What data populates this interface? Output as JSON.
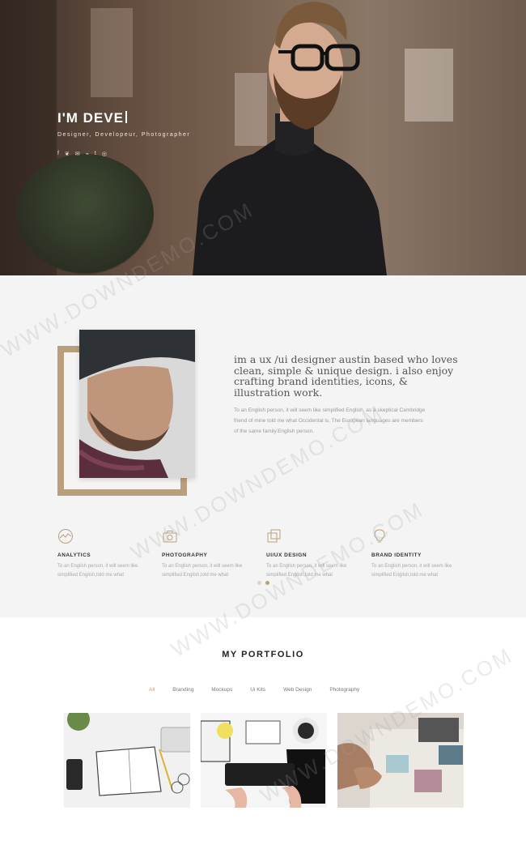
{
  "hero": {
    "title": "I'M DEVE",
    "subtitle": "Designer, Developeur, Photographer",
    "social_icons": [
      "facebook-icon",
      "twitter-icon",
      "email-icon",
      "rss-icon",
      "tumblr-icon",
      "instagram-icon"
    ],
    "social_glyphs": [
      "f",
      "❦",
      "✉",
      "⌁",
      "t",
      "◎"
    ]
  },
  "about": {
    "heading": "im a ux /ui designer austin based who loves clean, simple & unique design. i also enjoy crafting brand identities, icons, & illustration work.",
    "text": "To an English person, it will seem like simplified English, as a skeptical Cambridge friend of mine told me what Occidental is. The European languages are members of the same family.English person."
  },
  "services": [
    {
      "icon": "analytics-icon",
      "title": "ANALYTICS",
      "desc": "To an English person, it will seem like simplified English,told me what"
    },
    {
      "icon": "camera-icon",
      "title": "PHOTOGRAPHY",
      "desc": "To an English person, it will seem like simplified English,told me what"
    },
    {
      "icon": "layers-icon",
      "title": "UI/UX DESIGN",
      "desc": "To an English person, it will seem like simplified English,told me what"
    },
    {
      "icon": "lightbulb-icon",
      "title": "BRAND IDENTITY",
      "desc": "To an English person, it will seem like simplified English,told me what"
    }
  ],
  "portfolio": {
    "title": "MY PORTFOLIO",
    "filters": [
      "All",
      "Branding",
      "Mockups",
      "Ui Kits",
      "Web Design",
      "Photography"
    ],
    "active_filter": "All"
  },
  "watermark": "WWW.DOWNDEMO.COM",
  "colors": {
    "accent": "#b99f7d",
    "about_bg": "#f4f4f4"
  }
}
